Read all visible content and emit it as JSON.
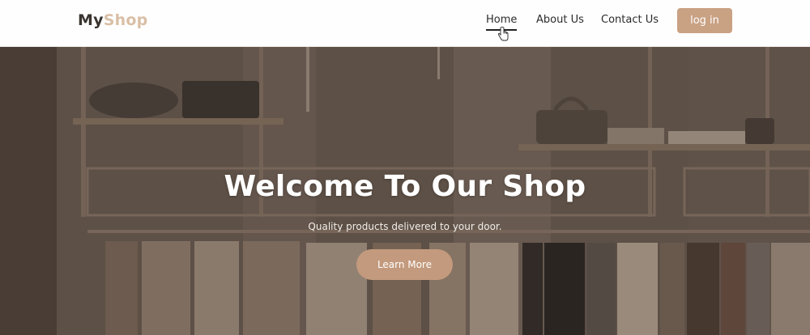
{
  "header": {
    "logo_part1": "My",
    "logo_part2": "Shop",
    "nav": [
      {
        "label": "Home",
        "active": true
      },
      {
        "label": "About Us",
        "active": false
      },
      {
        "label": "Contact Us",
        "active": false
      }
    ],
    "login_label": "log in"
  },
  "hero": {
    "title": "Welcome To Our Shop",
    "subtitle": "Quality products delivered to your door.",
    "cta_label": "Learn More"
  },
  "colors": {
    "accent": "#c9a183",
    "logo_dark": "#3a3430",
    "logo_light": "#d9bfa6",
    "hero_overlay": "#5b4e45"
  }
}
